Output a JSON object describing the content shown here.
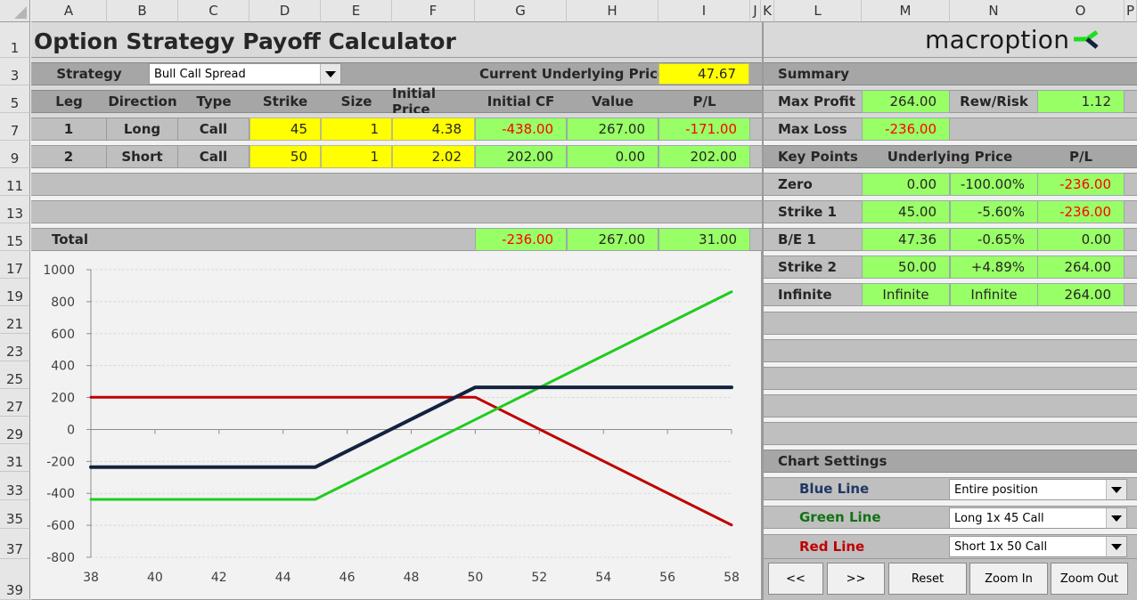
{
  "columns": [
    "A",
    "B",
    "C",
    "D",
    "E",
    "F",
    "G",
    "H",
    "I",
    "J",
    "K",
    "L",
    "M",
    "N",
    "O",
    "P"
  ],
  "rows": [
    "1",
    "3",
    "5",
    "7",
    "9",
    "11",
    "13",
    "15",
    "17",
    "19",
    "21",
    "23",
    "25",
    "27",
    "29",
    "31",
    "33",
    "35",
    "37",
    "39"
  ],
  "title": "Option Strategy Payoff Calculator",
  "logo": {
    "text": "macroption",
    "icon": "macroption-logo-icon"
  },
  "strategy": {
    "label": "Strategy",
    "value": "Bull Call Spread"
  },
  "underlying": {
    "label": "Current Underlying Price",
    "value": "47.67"
  },
  "legs_table": {
    "headers": [
      "Leg",
      "Direction",
      "Type",
      "Strike",
      "Size",
      "Initial Price",
      "Initial CF",
      "Value",
      "P/L"
    ],
    "rows": [
      {
        "leg": "1",
        "direction": "Long",
        "type": "Call",
        "strike": "45",
        "size": "1",
        "initial_price": "4.38",
        "initial_cf": "-438.00",
        "value": "267.00",
        "pl": "-171.00"
      },
      {
        "leg": "2",
        "direction": "Short",
        "type": "Call",
        "strike": "50",
        "size": "1",
        "initial_price": "2.02",
        "initial_cf": "202.00",
        "value": "0.00",
        "pl": "202.00"
      }
    ],
    "total": {
      "label": "Total",
      "initial_cf": "-236.00",
      "value": "267.00",
      "pl": "31.00"
    }
  },
  "summary": {
    "title": "Summary",
    "max_profit_label": "Max Profit",
    "max_profit": "264.00",
    "rew_risk_label": "Rew/Risk",
    "rew_risk": "1.12",
    "max_loss_label": "Max Loss",
    "max_loss": "-236.00"
  },
  "key_points": {
    "headers": [
      "Key Points",
      "Underlying Price",
      "P/L"
    ],
    "rows": [
      {
        "name": "Zero",
        "price": "0.00",
        "pct": "-100.00%",
        "pl": "-236.00",
        "neg": true
      },
      {
        "name": "Strike 1",
        "price": "45.00",
        "pct": "-5.60%",
        "pl": "-236.00",
        "neg": true
      },
      {
        "name": "B/E 1",
        "price": "47.36",
        "pct": "-0.65%",
        "pl": "0.00",
        "neg": false
      },
      {
        "name": "Strike 2",
        "price": "50.00",
        "pct": "+4.89%",
        "pl": "264.00",
        "neg": false
      },
      {
        "name": "Infinite",
        "price": "Infinite",
        "pct": "Infinite",
        "pl": "264.00",
        "neg": false
      }
    ]
  },
  "chart_settings": {
    "title": "Chart Settings",
    "blue_label": "Blue Line",
    "blue_value": "Entire position",
    "green_label": "Green Line",
    "green_value": "Long 1x 45 Call",
    "red_label": "Red Line",
    "red_value": "Short 1x 50 Call",
    "buttons": [
      "<<",
      ">>",
      "Reset",
      "Zoom In",
      "Zoom Out"
    ]
  },
  "colors": {
    "blue": "#13223f",
    "green": "#1fcc1f",
    "red": "#c00000",
    "yellow": "#ffff00",
    "cell_green": "#99ff66"
  },
  "chart_data": {
    "type": "line",
    "title": "",
    "xlabel": "",
    "ylabel": "",
    "x_ticks": [
      38,
      40,
      42,
      44,
      46,
      48,
      50,
      52,
      54,
      56,
      58
    ],
    "y_ticks": [
      1000,
      800,
      600,
      400,
      200,
      0,
      -200,
      -400,
      -600,
      -800
    ],
    "xlim": [
      38,
      58
    ],
    "ylim": [
      -800,
      1000
    ],
    "grid": true,
    "series": [
      {
        "name": "Entire position",
        "color": "blue",
        "x": [
          38,
          45,
          50,
          58
        ],
        "y": [
          -236,
          -236,
          264,
          264
        ]
      },
      {
        "name": "Long 1x 45 Call",
        "color": "green",
        "x": [
          38,
          45,
          58
        ],
        "y": [
          -438,
          -438,
          862
        ]
      },
      {
        "name": "Short 1x 50 Call",
        "color": "red",
        "x": [
          38,
          50,
          58
        ],
        "y": [
          202,
          202,
          -598
        ]
      }
    ]
  }
}
